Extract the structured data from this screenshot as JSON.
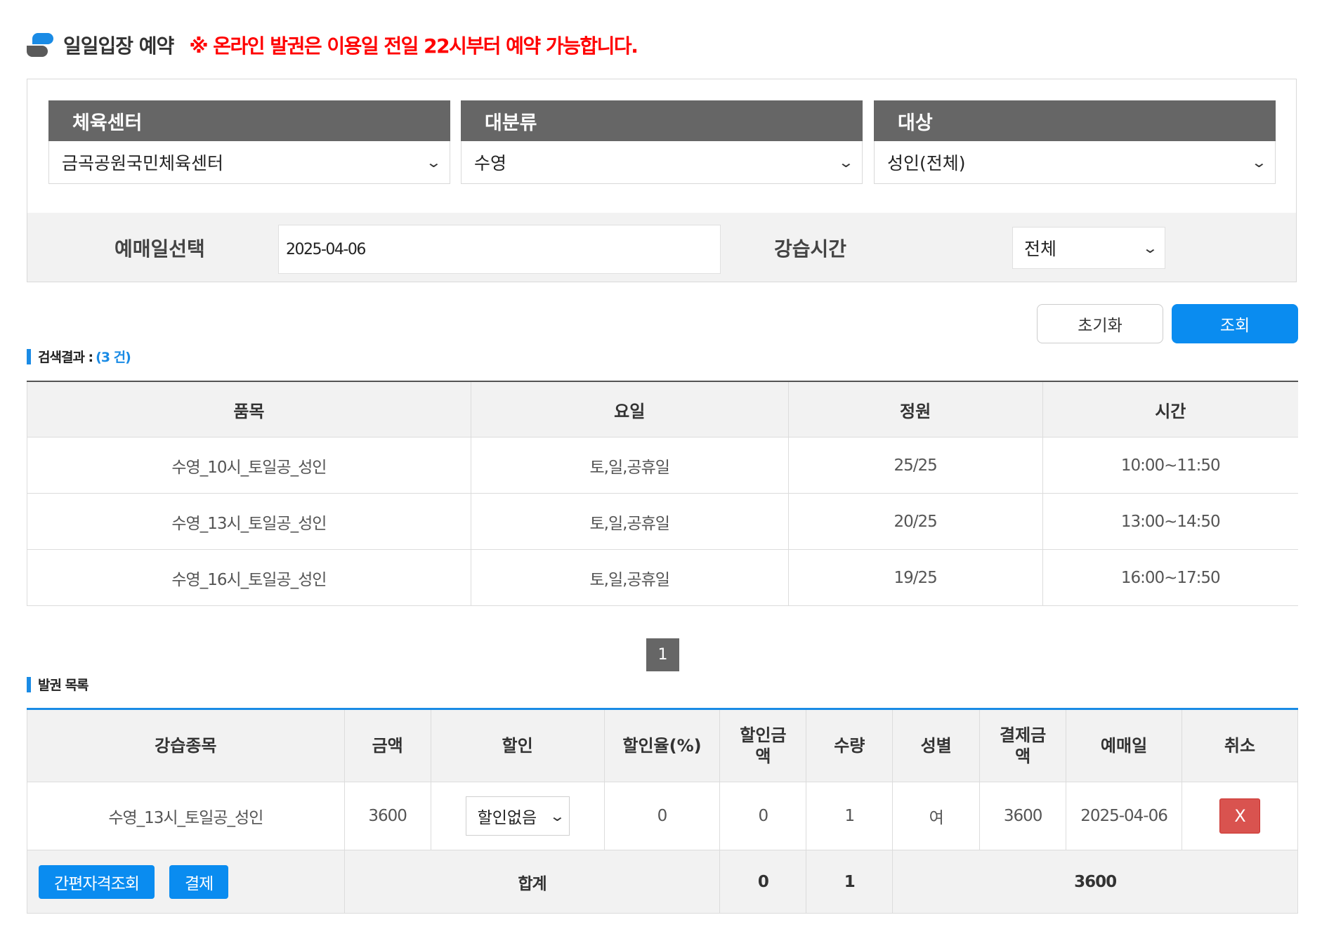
{
  "header": {
    "title": "일일입장 예약",
    "notice": "※ 온라인 발권은 이용일 전일 22시부터 예약 가능합니다."
  },
  "filters": [
    {
      "label": "체육센터",
      "value": "금곡공원국민체육센터"
    },
    {
      "label": "대분류",
      "value": "수영"
    },
    {
      "label": "대상",
      "value": "성인(전체)"
    }
  ],
  "date": {
    "label": "예매일선택",
    "value": "2025-04-06"
  },
  "time": {
    "label": "강습시간",
    "value": "전체"
  },
  "buttons": {
    "reset": "초기화",
    "search": "조회"
  },
  "results": {
    "label": "검색결과 :",
    "count": "(3 건)",
    "headers": [
      "품목",
      "요일",
      "정원",
      "시간"
    ],
    "rows": [
      [
        "수영_10시_토일공_성인",
        "토,일,공휴일",
        "25/25",
        "10:00~11:50"
      ],
      [
        "수영_13시_토일공_성인",
        "토,일,공휴일",
        "20/25",
        "13:00~14:50"
      ],
      [
        "수영_16시_토일공_성인",
        "토,일,공휴일",
        "19/25",
        "16:00~17:50"
      ]
    ]
  },
  "pagination": {
    "current": "1"
  },
  "tickets": {
    "label": "발권 목록",
    "headers": {
      "course": "강습종목",
      "price": "금액",
      "discount": "할인",
      "rate": "할인율(%)",
      "disc_amount_1": "할인금",
      "disc_amount_2": "액",
      "qty": "수량",
      "gender": "성별",
      "pay_1": "결제금",
      "pay_2": "액",
      "date": "예매일",
      "cancel": "취소"
    },
    "row": {
      "course": "수영_13시_토일공_성인",
      "price": "3600",
      "discount": "할인없음",
      "rate": "0",
      "disc_amount": "0",
      "qty": "1",
      "gender": "여",
      "pay": "3600",
      "date": "2025-04-06",
      "cancel": "X"
    },
    "total": {
      "quick_check": "간편자격조회",
      "pay_button": "결제",
      "label": "합계",
      "disc_amount": "0",
      "qty": "1",
      "pay": "3600"
    }
  }
}
